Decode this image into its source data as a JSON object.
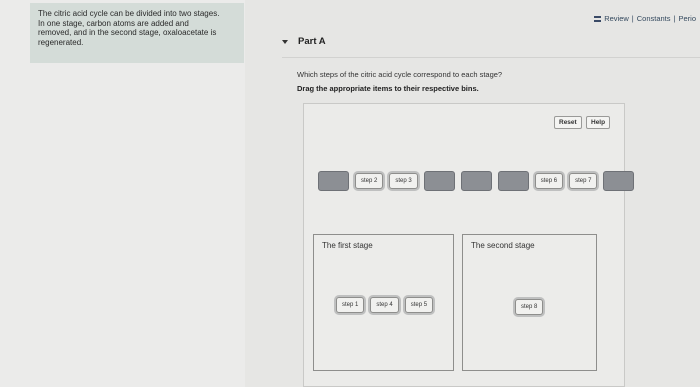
{
  "info": {
    "text": "The citric acid cycle can be divided into two stages.\nIn one stage, carbon atoms are added and\nremoved, and in the second stage, oxaloacetate is\nregenerated."
  },
  "review_bar": {
    "review": "Review",
    "separator1": "|",
    "constants": "Constants",
    "separator2": "|",
    "periodic": "Perio"
  },
  "part": {
    "title": "Part A"
  },
  "question": "Which steps of the citric acid cycle correspond to each stage?",
  "instruction": "Drag the appropriate items to their respective bins.",
  "toolbar": {
    "reset_label": "Reset",
    "help_label": "Help"
  },
  "token_row": [
    {
      "type": "slot"
    },
    {
      "type": "chip",
      "label": "step 2"
    },
    {
      "type": "chip",
      "label": "step 3"
    },
    {
      "type": "slot"
    },
    {
      "type": "slot"
    },
    {
      "type": "slot"
    },
    {
      "type": "chip",
      "label": "step 6"
    },
    {
      "type": "chip",
      "label": "step 7"
    },
    {
      "type": "slot"
    }
  ],
  "bins": {
    "first": {
      "title": "The first stage",
      "items": [
        "step 1",
        "step 4",
        "step 5"
      ]
    },
    "second": {
      "title": "The second stage",
      "items": [
        "step 8"
      ]
    }
  },
  "colors": {
    "slot": "#8c8f94",
    "info_panel": "#d4dcd8",
    "link": "#34495e"
  }
}
